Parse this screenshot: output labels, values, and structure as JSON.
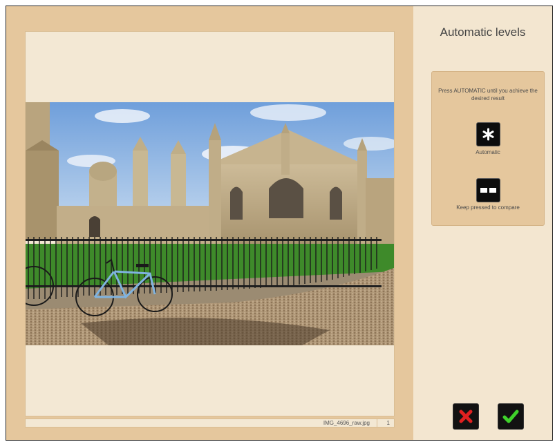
{
  "panel": {
    "title": "Automatic levels",
    "instructions": "Press AUTOMATIC until you achieve the desired result",
    "automatic_label": "Automatic",
    "compare_label": "Keep pressed to compare"
  },
  "status": {
    "filename": "IMG_4696_raw.jpg",
    "page": "1"
  },
  "icons": {
    "automatic": "asterisk-icon",
    "compare": "compare-icon",
    "cancel": "x-icon",
    "confirm": "checkmark-icon"
  },
  "colors": {
    "frame": "#e5c79d",
    "panel_bg": "#f3e6d0",
    "canvas_bg": "#f3e8d4",
    "cancel_red": "#e02020",
    "confirm_green": "#3fd22b"
  }
}
